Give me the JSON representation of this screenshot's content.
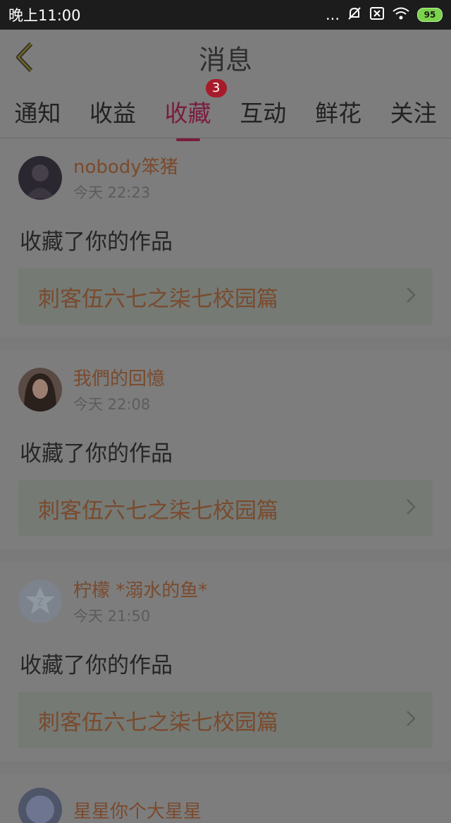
{
  "status_bar": {
    "time": "晚上11:00",
    "dots": "...",
    "battery": "95"
  },
  "header": {
    "title": "消息"
  },
  "tabs": [
    {
      "label": "通知"
    },
    {
      "label": "收益"
    },
    {
      "label": "收藏",
      "badge": "3"
    },
    {
      "label": "互动"
    },
    {
      "label": "鲜花"
    },
    {
      "label": "关注"
    }
  ],
  "messages": [
    {
      "username": "nobody笨猪",
      "time": "今天 22:23",
      "action": "收藏了你的作品",
      "work": "刺客伍六七之柒七校园篇"
    },
    {
      "username": "我們的回憶",
      "time": "今天 22:08",
      "action": "收藏了你的作品",
      "work": "刺客伍六七之柒七校园篇"
    },
    {
      "username": "柠檬 *溺水的鱼*",
      "time": "今天 21:50",
      "action": "收藏了你的作品",
      "work": "刺客伍六七之柒七校园篇"
    },
    {
      "username": "星星你个大星星"
    }
  ],
  "colors": {
    "accent": "#7a1c3e",
    "badge": "#a61b2a",
    "username": "#7a4a2d"
  }
}
